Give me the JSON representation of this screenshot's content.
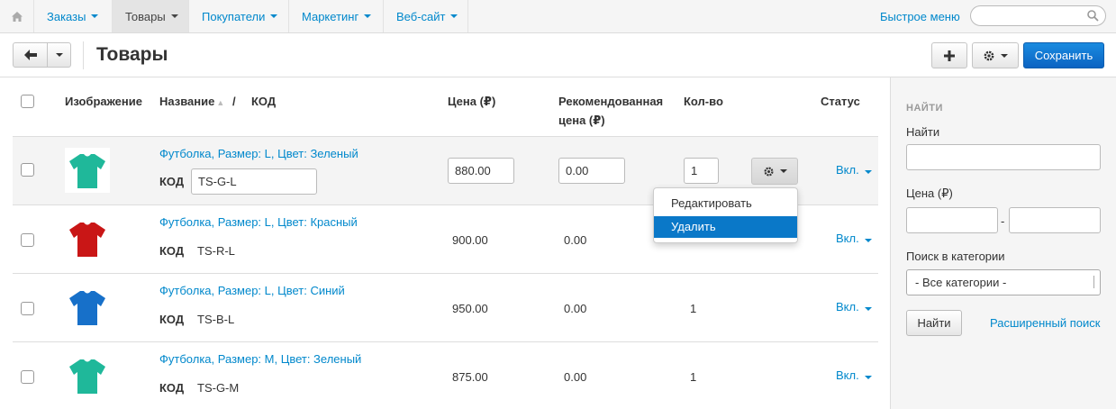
{
  "nav": {
    "items": [
      {
        "label": "Заказы"
      },
      {
        "label": "Товары"
      },
      {
        "label": "Покупатели"
      },
      {
        "label": "Маркетинг"
      },
      {
        "label": "Веб-сайт"
      }
    ],
    "quick_menu": "Быстрое меню",
    "search_placeholder": ""
  },
  "toolbar": {
    "title": "Товары",
    "save_label": "Сохранить"
  },
  "table": {
    "headers": {
      "image": "Изображение",
      "name": "Название",
      "sep": "/",
      "code": "КОД",
      "price": "Цена (₽)",
      "rec_price_1": "Рекомендованная",
      "rec_price_2": "цена (₽)",
      "qty": "Кол-во",
      "status": "Статус"
    },
    "rows": [
      {
        "name": "Футболка, Размер: L, Цвет: Зеленый",
        "code_label": "КОД",
        "code": "TS-G-L",
        "price": "880.00",
        "rec_price": "0.00",
        "qty": "1",
        "status": "Вкл.",
        "color": "#1fb89a"
      },
      {
        "name": "Футболка, Размер: L, Цвет: Красный",
        "code_label": "КОД",
        "code": "TS-R-L",
        "price": "900.00",
        "rec_price": "0.00",
        "qty": "",
        "status": "Вкл.",
        "color": "#c91616"
      },
      {
        "name": "Футболка, Размер: L, Цвет: Синий",
        "code_label": "КОД",
        "code": "TS-B-L",
        "price": "950.00",
        "rec_price": "0.00",
        "qty": "1",
        "status": "Вкл.",
        "color": "#1770c9"
      },
      {
        "name": "Футболка, Размер: M, Цвет: Зеленый",
        "code_label": "КОД",
        "code": "TS-G-M",
        "price": "875.00",
        "rec_price": "0.00",
        "qty": "1",
        "status": "Вкл.",
        "color": "#1fb89a"
      }
    ],
    "dropdown": {
      "edit": "Редактировать",
      "delete": "Удалить"
    }
  },
  "sidebar": {
    "heading": "НАЙТИ",
    "find_label": "Найти",
    "price_label": "Цена (₽)",
    "price_sep": "-",
    "category_label": "Поиск в категории",
    "category_value": "- Все категории -",
    "find_button": "Найти",
    "advanced_search": "Расширенный поиск"
  },
  "colors": {
    "link": "#0088cc",
    "primary_button": "#0b63c2",
    "highlight": "#0a78c8"
  }
}
